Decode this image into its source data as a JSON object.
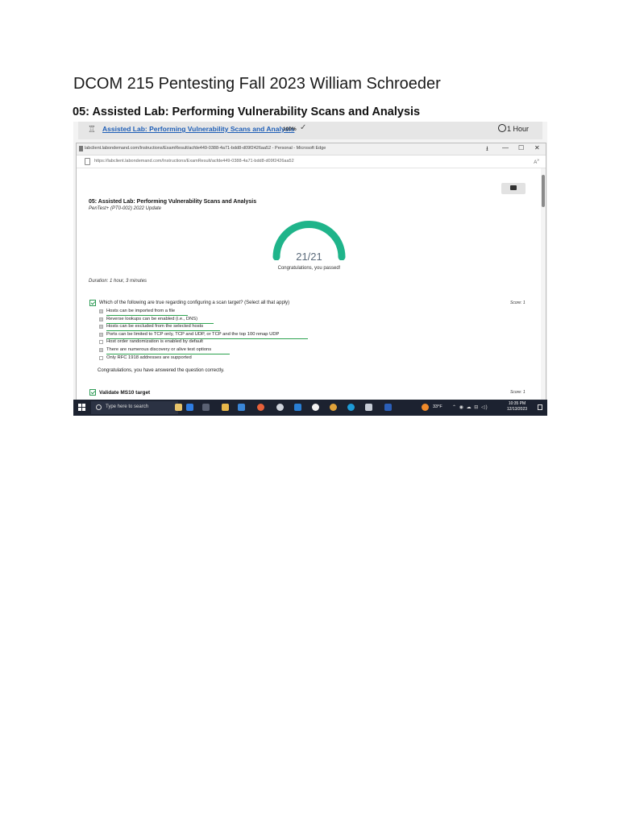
{
  "document": {
    "title": "DCOM 215 Pentesting Fall 2023 William Schroeder",
    "lab_heading": "05: Assisted Lab: Performing Vulnerability Scans and Analysis"
  },
  "lab_bar": {
    "link": "Assisted Lab: Performing Vulnerability Scans and Analysis",
    "percent": "100%",
    "duration": "1 Hour"
  },
  "browser": {
    "window_title": "labclient.labondemand.com/Instructions/ExamResult/acfde449-0388-4a71-bdd8-d09f2426aa52 - Personal - Microsoft Edge",
    "url": "https://labclient.labondemand.com/Instructions/ExamResult/acfde449-0388-4a71-bdd8-d09f2426aa52",
    "controls": [
      "—",
      "☐",
      "✕"
    ]
  },
  "result": {
    "title": "05: Assisted Lab: Performing Vulnerability Scans and Analysis",
    "subtitle": "PenTest+ (PT0-002) 2022 Update",
    "score_text": "21/21",
    "score_fraction": 1.0,
    "passed_text": "Congratulations, you passed!",
    "duration": "Duration: 1 hour, 3 minutes"
  },
  "question1": {
    "text": "Which of the following are true regarding configuring a scan target? (Select all that apply)",
    "score": "Score: 1",
    "options": [
      {
        "label": "Hosts can be imported from a file",
        "checked": true,
        "correct": true
      },
      {
        "label": "Reverse lookups can be enabled (i.e., DNS)",
        "checked": true,
        "correct": true
      },
      {
        "label": "Hosts can be excluded from the selected hosts",
        "checked": true,
        "correct": true
      },
      {
        "label": "Ports can be limited to TCP only, TCP and UDP, or TCP and the top 100 nmap UDP",
        "checked": true,
        "correct": true
      },
      {
        "label": "Host order randomization is enabled by default",
        "checked": false,
        "correct": false
      },
      {
        "label": "There are numerous discovery or alive test options",
        "checked": true,
        "correct": true
      },
      {
        "label": "Only RFC 1918 addresses are supported",
        "checked": false,
        "correct": false
      }
    ],
    "feedback": "Congratulations, you have answered the question correctly."
  },
  "question2": {
    "text": "Validate MS10 target",
    "score": "Score: 1"
  },
  "taskbar": {
    "search_placeholder": "Type here to search",
    "temperature": "33°F",
    "time": "10:35 PM",
    "date": "12/13/2023"
  },
  "colors": {
    "gauge": "#1fb48a",
    "link": "#1f5fb7",
    "correct_underline": "#2ca24f",
    "taskbar": "#1c2230"
  }
}
